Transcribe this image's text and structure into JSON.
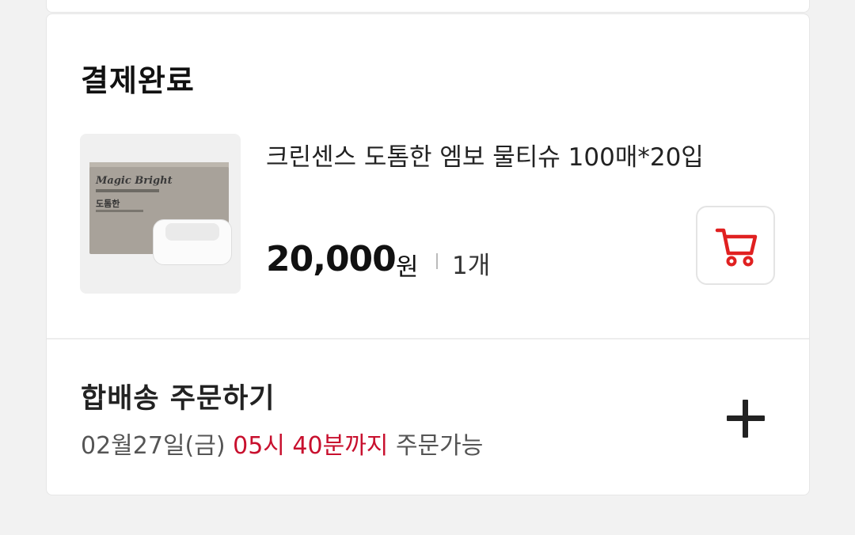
{
  "section": {
    "title": "결제완료"
  },
  "product": {
    "image_brand": "Magic Bright",
    "image_subtitle": "도톰한",
    "name": "크린센스 도톰한 엠보 물티슈 100매*20입",
    "price": "20,000",
    "currency": "원",
    "quantity": "1개",
    "cart_icon": "cart-icon",
    "accent_color": "#e02020"
  },
  "bundle": {
    "title": "합배송 주문하기",
    "date": "02월27일(금)",
    "deadline": "05시 40분까지",
    "suffix": "주문가능",
    "highlight_color": "#c8102e",
    "expand_icon": "plus-icon"
  }
}
